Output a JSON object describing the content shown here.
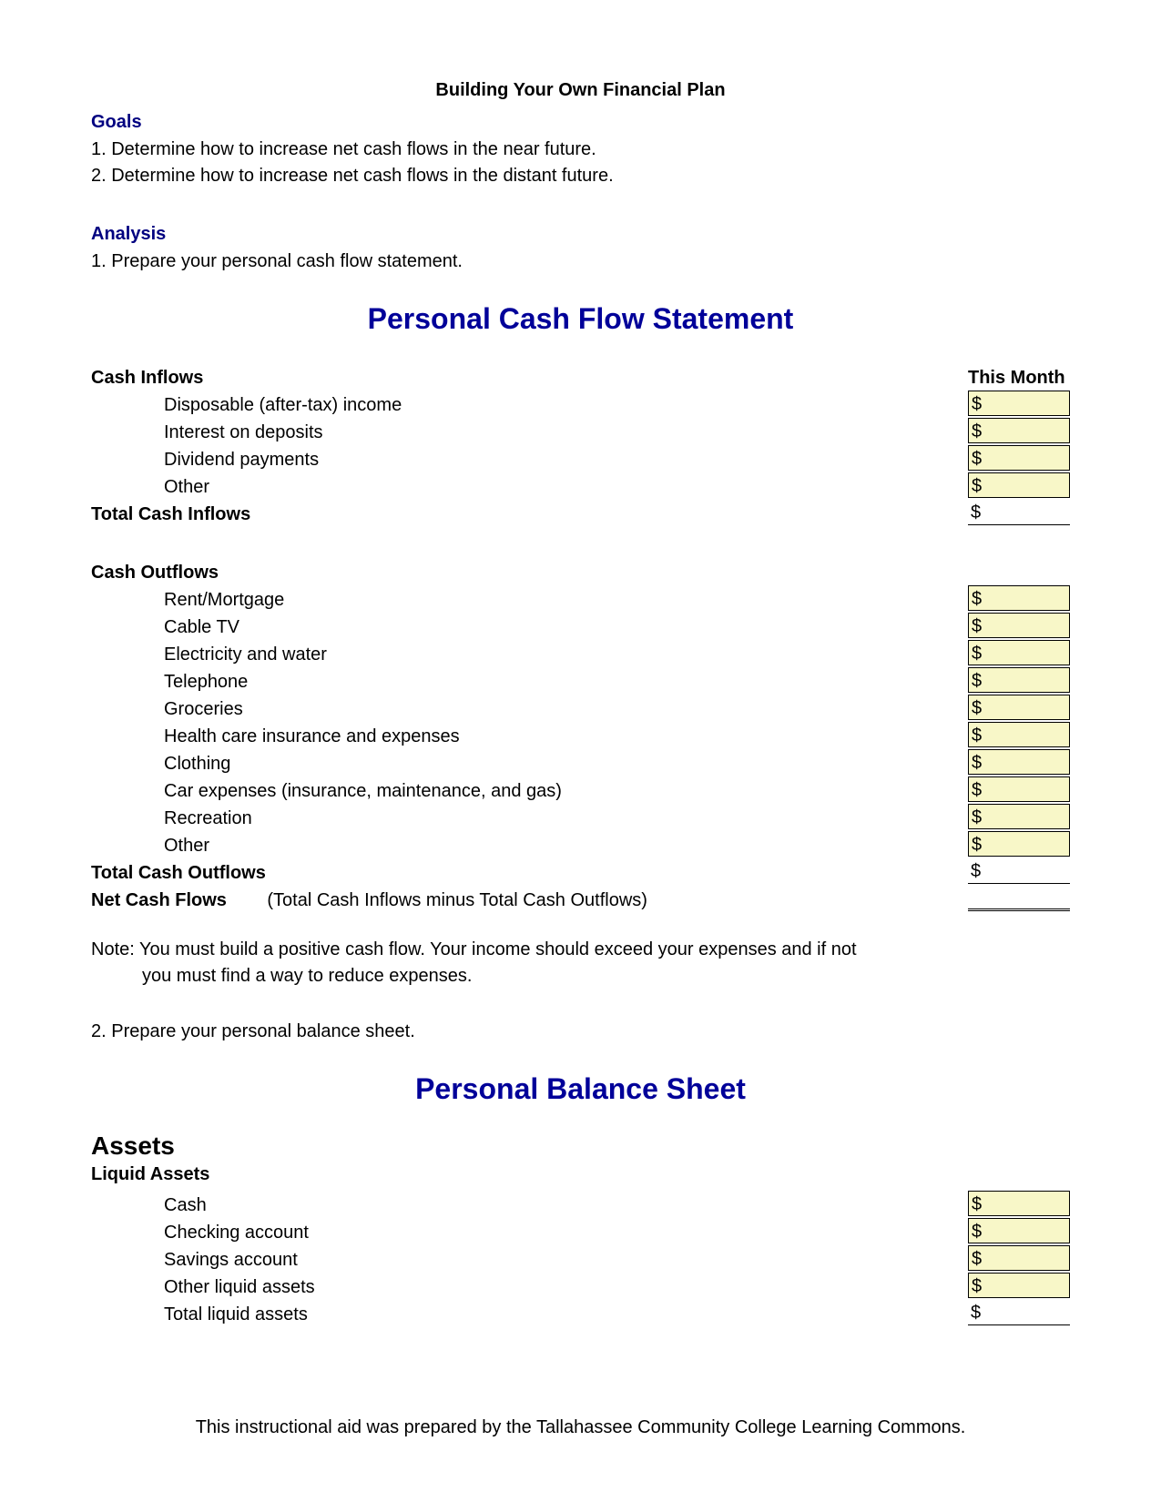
{
  "doc": {
    "title": "Building Your Own Financial Plan",
    "goals_heading": "Goals",
    "goals": [
      "1. Determine how to increase net cash flows in the near future.",
      "2. Determine how to increase net cash flows in the distant future."
    ],
    "analysis_heading": "Analysis",
    "analysis_items": [
      "1. Prepare your personal cash flow statement."
    ],
    "cashflow_title": "Personal Cash Flow Statement",
    "inflows_label": "Cash Inflows",
    "this_month_label": "This Month",
    "dollar": "$",
    "inflows": [
      "Disposable (after-tax) income",
      "Interest on deposits",
      "Dividend payments",
      "Other"
    ],
    "total_inflows_label": "Total Cash Inflows",
    "outflows_label": "Cash Outflows",
    "outflows": [
      "Rent/Mortgage",
      "Cable TV",
      "Electricity and water",
      "Telephone",
      "Groceries",
      "Health care insurance and expenses",
      "Clothing",
      "Car expenses (insurance, maintenance, and gas)",
      "Recreation",
      "Other"
    ],
    "total_outflows_label": "Total Cash Outflows",
    "net_label": "Net Cash Flows",
    "net_paren": "(Total Cash Inflows minus Total Cash Outflows)",
    "note_line1": "Note: You must build a positive cash flow.  Your income should exceed your expenses and if not",
    "note_line2": "you must find a way to reduce expenses.",
    "analysis2": "2. Prepare your personal balance sheet.",
    "balance_title": "Personal Balance Sheet",
    "assets_heading": "Assets",
    "liquid_heading": "Liquid Assets",
    "liquid_items": [
      "Cash",
      "Checking account",
      "Savings account",
      "Other liquid assets"
    ],
    "total_liquid_label": "Total liquid assets",
    "footer": "This instructional aid was prepared by the Tallahassee Community College Learning Commons."
  }
}
